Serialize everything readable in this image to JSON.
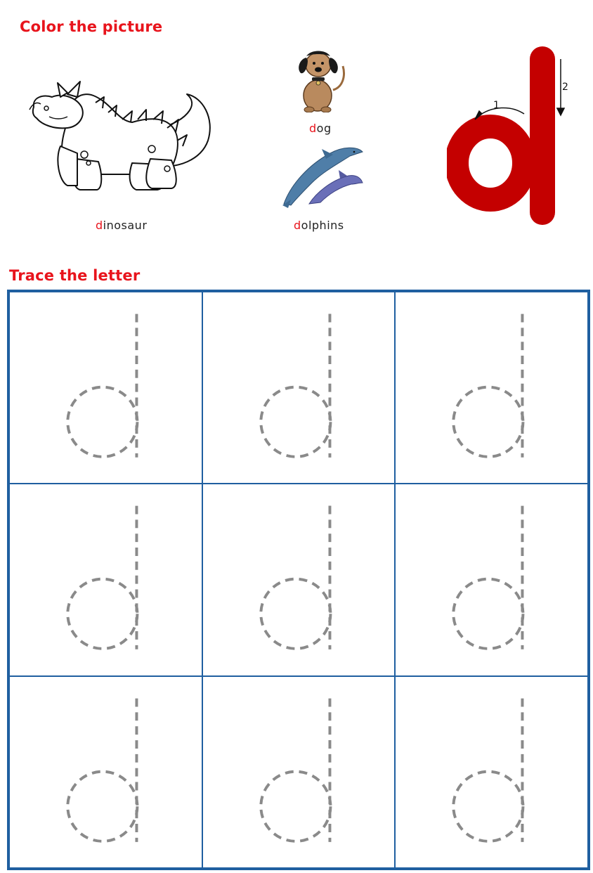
{
  "sections": {
    "color_heading": "Color the picture",
    "trace_heading": "Trace the letter"
  },
  "pictures": [
    {
      "icon": "dinosaur-outline",
      "first": "d",
      "rest": "inosaur"
    },
    {
      "icon": "dog",
      "first": "d",
      "rest": "og"
    },
    {
      "icon": "dolphins",
      "first": "d",
      "rest": "olphins"
    }
  ],
  "model_letter": {
    "letter": "d",
    "stroke_1": "1",
    "stroke_2": "2",
    "color": "#c40000"
  },
  "tracing": {
    "rows": 3,
    "columns": 3,
    "letter": "d",
    "dash_color": "#8a8a8a",
    "grid_color": "#1f5fa0"
  }
}
